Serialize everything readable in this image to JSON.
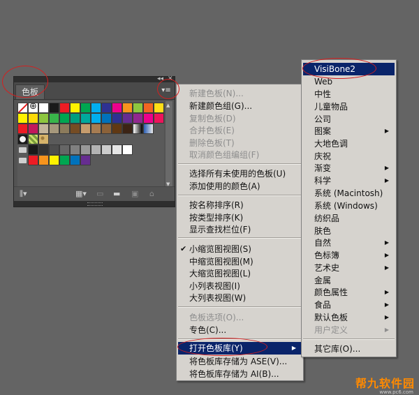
{
  "panel": {
    "controls": {
      "collapse": "◂◂",
      "close": "✕"
    },
    "tab_label": "色板",
    "menu_button_icon": "▾≡",
    "swatch_rows": [
      [
        "none",
        "reg",
        "#ffffff",
        "#1a1a1a",
        "#ed1c24",
        "#fff200",
        "#00a651",
        "#00aeef",
        "#2e3192",
        "#ec008c",
        "#f7941d",
        "#8dc63f",
        "#f26522",
        "#ffde17"
      ],
      [
        "#fff200",
        "#fbd908",
        "#8dc63f",
        "#39b54a",
        "#00a651",
        "#009e7f",
        "#00a99d",
        "#00aeef",
        "#0072bc",
        "#2e3192",
        "#662d91",
        "#92278f",
        "#ec008c",
        "#ed145b"
      ],
      [
        "#ed1c24",
        "#c2185b",
        "#c4b59c",
        "#a6987c",
        "#8c7b5c",
        "#754c24",
        "#c69c6d",
        "#a67c52",
        "#8c6239",
        "#603813",
        "#3c2415",
        "grad",
        "grad2"
      ],
      [
        "circle",
        "pattern2",
        "pattern"
      ],
      [
        "folder",
        "#1a1a1a",
        "#333333",
        "#4d4d4d",
        "#666666",
        "#808080",
        "#999999",
        "#b3b3b3",
        "#cccccc",
        "#e6e6e6",
        "#ffffff"
      ],
      [
        "folder",
        "#ed1c24",
        "#f7941d",
        "#fff200",
        "#00a651",
        "#0072bc",
        "#662d91"
      ]
    ],
    "footer_icons": [
      "library-icon",
      "swatch-kind-icon",
      "swatch-options-icon",
      "new-group-icon",
      "new-swatch-icon",
      "delete-icon"
    ]
  },
  "context_menu": {
    "items": [
      {
        "label": "新建色板(N)...",
        "disabled": true
      },
      {
        "label": "新建颜色组(G)...",
        "disabled": false
      },
      {
        "label": "复制色板(D)",
        "disabled": true
      },
      {
        "label": "合并色板(E)",
        "disabled": true
      },
      {
        "label": "删除色板(T)",
        "disabled": true
      },
      {
        "label": "取消颜色组编组(F)",
        "disabled": true
      },
      {
        "label": "选择所有未使用的色板(U)",
        "disabled": false
      },
      {
        "label": "添加使用的颜色(A)",
        "disabled": false
      },
      {
        "label": "按名称排序(R)",
        "disabled": false
      },
      {
        "label": "按类型排序(K)",
        "disabled": false
      },
      {
        "label": "显示查找栏位(F)",
        "disabled": false
      },
      {
        "label": "小缩览图视图(S)",
        "disabled": false,
        "checked": true
      },
      {
        "label": "中缩览图视图(M)",
        "disabled": false
      },
      {
        "label": "大缩览图视图(L)",
        "disabled": false
      },
      {
        "label": "小列表视图(I)",
        "disabled": false
      },
      {
        "label": "大列表视图(W)",
        "disabled": false
      },
      {
        "label": "色板选项(O)...",
        "disabled": true
      },
      {
        "label": "专色(C)...",
        "disabled": false
      },
      {
        "label": "打开色板库(Y)",
        "disabled": false,
        "highlight": true,
        "submenu": true
      },
      {
        "label": "将色板库存储为 ASE(V)...",
        "disabled": false
      },
      {
        "label": "将色板库存储为 AI(B)...",
        "disabled": false
      }
    ]
  },
  "library_menu": {
    "items": [
      {
        "label": "VisiBone2",
        "highlight": true
      },
      {
        "label": "Web"
      },
      {
        "label": "中性"
      },
      {
        "label": "儿童物品"
      },
      {
        "label": "公司"
      },
      {
        "label": "图案",
        "submenu": true
      },
      {
        "label": "大地色调"
      },
      {
        "label": "庆祝"
      },
      {
        "label": "渐变",
        "submenu": true
      },
      {
        "label": "科学",
        "submenu": true
      },
      {
        "label": "系统 (Macintosh)"
      },
      {
        "label": "系统 (Windows)"
      },
      {
        "label": "纺织品"
      },
      {
        "label": "肤色"
      },
      {
        "label": "自然",
        "submenu": true
      },
      {
        "label": "色标簿",
        "submenu": true
      },
      {
        "label": "艺术史",
        "submenu": true
      },
      {
        "label": "金属"
      },
      {
        "label": "颜色属性",
        "submenu": true
      },
      {
        "label": "食品",
        "submenu": true
      },
      {
        "label": "默认色板",
        "submenu": true
      },
      {
        "label": "用户定义",
        "disabled": true,
        "submenu": true
      },
      {
        "label": "其它库(O)..."
      }
    ]
  },
  "watermark": {
    "text": "帮九软件园",
    "url": "www.pc6.com"
  },
  "accent_colors": {
    "highlight": "#0a246a",
    "annotation": "#d42020",
    "watermark": "#ff8a00"
  }
}
